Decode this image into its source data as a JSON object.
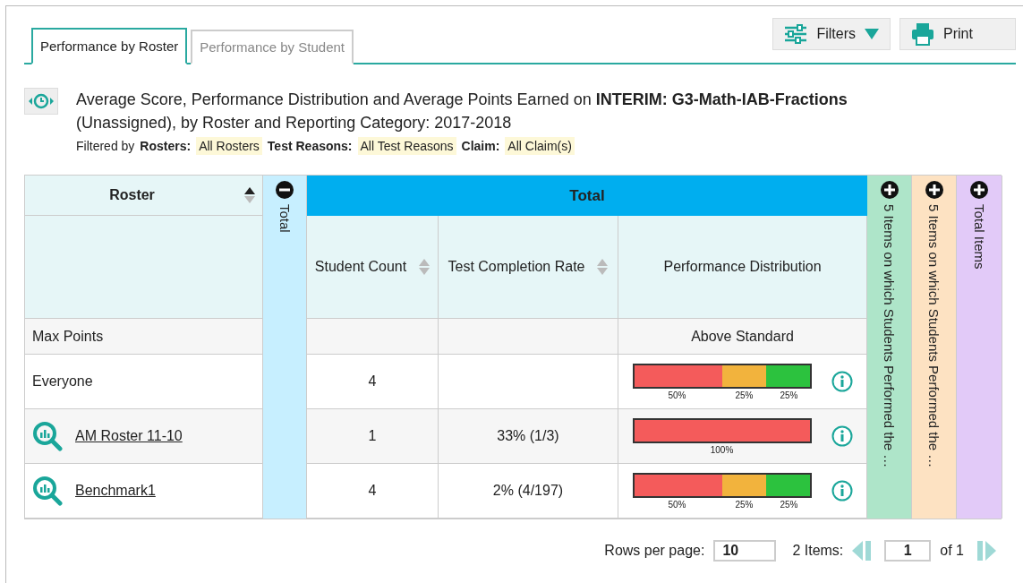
{
  "tabs": [
    {
      "label": "Performance by Roster",
      "selected": true
    },
    {
      "label": "Performance by Student",
      "selected": false
    }
  ],
  "toolbar": [
    {
      "kind": "filters",
      "label": "Filters"
    },
    {
      "kind": "print",
      "label": "Print"
    }
  ],
  "report": {
    "title": "Average Score, Performance Distribution and Average Points Earned on **INTERIM: G3-Math-IAB-Fractions** (Unassigned), by Roster and Reporting Category: 2017-2018",
    "filter_label": "Filtered by",
    "filters": [
      {
        "name": "Rosters:",
        "value": "All Rosters"
      },
      {
        "name": "Test Reasons:",
        "value": "All Test Reasons"
      },
      {
        "name": "Claim:",
        "value": "All Claim(s)"
      }
    ]
  },
  "table": {
    "roster_column": {
      "label": "Roster",
      "sorted": true
    },
    "total_column": {
      "label": "Total",
      "expanded": true
    },
    "group_header": "Total",
    "columns": [
      {
        "label": "Student Count",
        "sortable": true,
        "sorted": false
      },
      {
        "label": "Test Completion Rate",
        "sortable": true,
        "sorted": false
      },
      {
        "label": "Performance Distribution",
        "sortable": false
      }
    ],
    "rows": [
      {
        "kind": "max",
        "name": "Max Points",
        "count": "",
        "rate": "",
        "distribution_label": "Above Standard"
      },
      {
        "kind": "group",
        "name": "Everyone",
        "count": "4",
        "rate": "",
        "segments": [
          {
            "label": "50%",
            "color": "#f45b5b"
          },
          {
            "label": "25%",
            "color": "#f2b33d"
          },
          {
            "label": "25%",
            "color": "#2cc23e"
          }
        ]
      },
      {
        "kind": "roster",
        "name": "AM Roster 11-10",
        "count": "1",
        "rate": "33% (1/3)",
        "segments": [
          {
            "label": "100%",
            "color": "#f45b5b"
          }
        ]
      },
      {
        "kind": "roster",
        "name": "Benchmark1",
        "count": "4",
        "rate": "2% (4/197)",
        "segments": [
          {
            "label": "50%",
            "color": "#f45b5b"
          },
          {
            "label": "25%",
            "color": "#f2b33d"
          },
          {
            "label": "25%",
            "color": "#2cc23e"
          }
        ]
      }
    ],
    "side_columns": [
      {
        "label": "5 Items on which Students Performed the …",
        "expanded": false,
        "color": "#aee5c9"
      },
      {
        "label": "5 Items on which Students Performed the …",
        "expanded": false,
        "color": "#fde2c2"
      },
      {
        "label": "Total Items",
        "expanded": false,
        "color": "#e2caf8"
      }
    ]
  },
  "pagination": {
    "rows_label": "Rows per page:",
    "rows_value": "10",
    "items_label": "2 Items:",
    "page_value": "1",
    "of_label": "of 1"
  }
}
